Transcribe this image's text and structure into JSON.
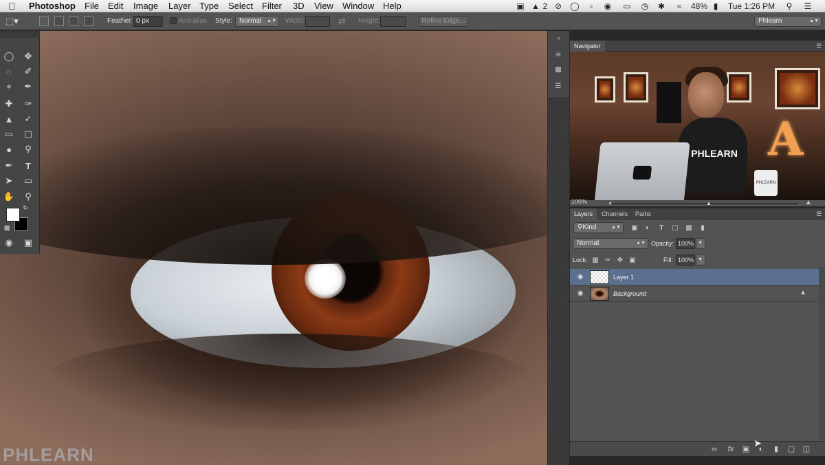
{
  "menubar": {
    "app": "Photoshop",
    "items": [
      "File",
      "Edit",
      "Image",
      "Layer",
      "Type",
      "Select",
      "Filter",
      "3D",
      "View",
      "Window",
      "Help"
    ],
    "status": {
      "badge": "2",
      "battery": "48%",
      "clock": "Tue 1:26 PM"
    }
  },
  "options": {
    "feather_label": "Feather:",
    "feather_value": "0 px",
    "antialias_label": "Anti-alias",
    "style_label": "Style:",
    "style_value": "Normal",
    "width_label": "Width:",
    "height_label": "Height:",
    "refine_label": "Refine Edge...",
    "workspace": "Phlearn"
  },
  "watermark": "PHLEARN",
  "navigator": {
    "tab": "Navigator",
    "zoom": "100%",
    "shirt_text": "PHLEARN",
    "mug_text": "PHLEARN",
    "sign_letter": "A"
  },
  "layers": {
    "tabs": [
      "Layers",
      "Channels",
      "Paths"
    ],
    "filter_value": "Kind",
    "blend_value": "Normal",
    "opacity_label": "Opacity:",
    "opacity_value": "100%",
    "lock_label": "Lock:",
    "fill_label": "Fill:",
    "fill_value": "100%",
    "items": [
      {
        "name": "Layer 1"
      },
      {
        "name": "Background"
      }
    ]
  },
  "colors": {
    "accent": "#5b6f8e",
    "panel": "#535353",
    "canvas_bg": "#282828"
  }
}
